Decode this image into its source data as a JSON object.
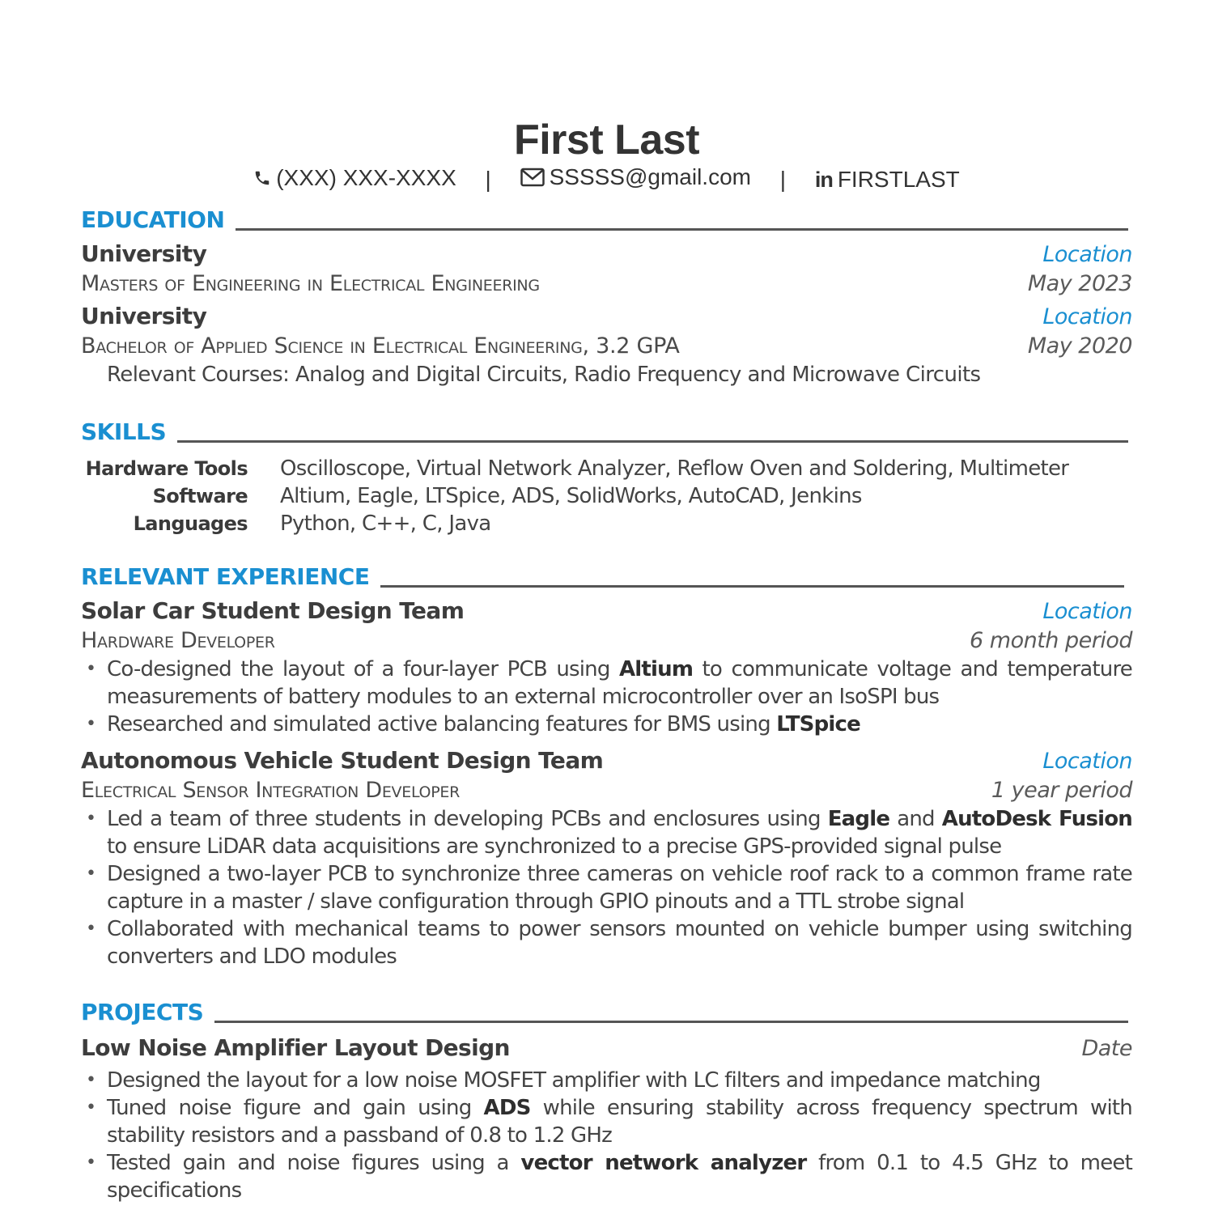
{
  "header": {
    "name": "First Last",
    "phone": "(XXX) XXX-XXXX",
    "email": "SSSSS@gmail.com",
    "linkedin": "FIRSTLAST",
    "separator": "|",
    "icons": {
      "phone": "phone-icon",
      "email": "envelope-icon",
      "linkedin": "linkedin-icon"
    }
  },
  "colors": {
    "accent": "#1a8fd1",
    "text": "#3a3a3a",
    "rule": "#555555"
  },
  "education": {
    "title": "EDUCATION",
    "entries": [
      {
        "school": "University",
        "location": "Location",
        "degree": "Masters of Engineering in Electrical Engineering",
        "date": "May 2023"
      },
      {
        "school": "University",
        "location": "Location",
        "degree": "Bachelor of Applied Science in Electrical Engineering, 3.2 GPA",
        "date": "May 2020",
        "courses": "Relevant Courses: Analog and Digital Circuits, Radio Frequency and Microwave Circuits"
      }
    ]
  },
  "skills": {
    "title": "SKILLS",
    "rows": [
      {
        "label": "Hardware Tools",
        "value": "Oscilloscope, Virtual Network Analyzer, Reflow Oven and Soldering, Multimeter"
      },
      {
        "label": "Software",
        "value": "Altium, Eagle, LTSpice, ADS, SolidWorks, AutoCAD, Jenkins"
      },
      {
        "label": "Languages",
        "value": "Python, C++, C, Java"
      }
    ]
  },
  "experience": {
    "title": "RELEVANT EXPERIENCE",
    "entries": [
      {
        "org": "Solar Car Student Design Team",
        "location": "Location",
        "role": "Hardware Developer",
        "period": "6 month period",
        "bullets": [
          [
            {
              "t": "Co-designed the layout of a four-layer PCB using "
            },
            {
              "t": "Altium",
              "b": true
            },
            {
              "t": " to communicate voltage and temperature measurements of battery modules to an external microcontroller over an IsoSPI bus"
            }
          ],
          [
            {
              "t": "Researched and simulated active balancing features for BMS using "
            },
            {
              "t": "LTSpice",
              "b": true
            }
          ]
        ]
      },
      {
        "org": "Autonomous Vehicle Student Design Team",
        "location": "Location",
        "role": "Electrical Sensor Integration Developer",
        "period": "1 year period",
        "bullets": [
          [
            {
              "t": "Led a team of three students in developing PCBs and enclosures using "
            },
            {
              "t": "Eagle",
              "b": true
            },
            {
              "t": " and "
            },
            {
              "t": "AutoDesk Fusion",
              "b": true
            },
            {
              "t": " to ensure LiDAR data acquisitions are synchronized to a precise GPS-provided signal pulse"
            }
          ],
          [
            {
              "t": "Designed a two-layer PCB to synchronize three cameras on vehicle roof rack to a common frame rate capture in a master / slave configuration through GPIO pinouts and a TTL strobe signal"
            }
          ],
          [
            {
              "t": "Collaborated with mechanical teams to power sensors mounted on vehicle bumper using switching converters and LDO modules"
            }
          ]
        ]
      }
    ]
  },
  "projects": {
    "title": "PROJECTS",
    "entries": [
      {
        "name": "Low Noise Amplifier Layout Design",
        "date": "Date",
        "bullets": [
          [
            {
              "t": "Designed the layout for a low noise MOSFET amplifier with LC filters and impedance matching"
            }
          ],
          [
            {
              "t": "Tuned noise figure and gain using "
            },
            {
              "t": "ADS",
              "b": true
            },
            {
              "t": " while ensuring stability across frequency spectrum with stability resistors and a passband of 0.8 to 1.2 GHz"
            }
          ],
          [
            {
              "t": "Tested gain and noise figures using a "
            },
            {
              "t": "vector network analyzer",
              "b": true
            },
            {
              "t": " from 0.1 to 4.5 GHz to meet specifications"
            }
          ]
        ]
      }
    ]
  }
}
